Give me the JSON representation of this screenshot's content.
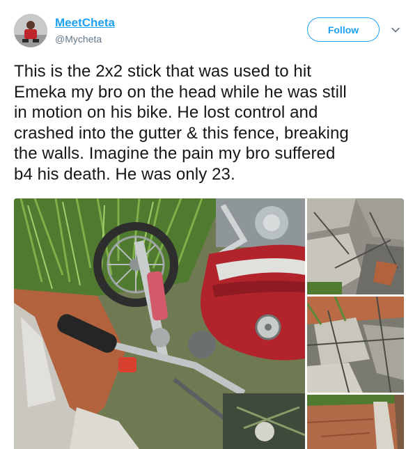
{
  "author": {
    "display_name": "MeetCheta",
    "handle": "@Mycheta",
    "avatar_icon": "profile-avatar"
  },
  "actions": {
    "follow_label": "Follow",
    "more_icon": "chevron-down-icon"
  },
  "tweet": {
    "text_lines": [
      "This is the 2x2 stick that was used to hit",
      "Emeka my bro on the head while he was still",
      "in motion on his bike. He lost control and",
      "crashed into the gutter & this fence, breaking",
      "the walls. Imagine the pain my bro suffered",
      "b4 his death. He was only 23."
    ]
  },
  "media": {
    "photo_count": 4
  },
  "colors": {
    "accent": "#1da1f2",
    "text": "#14171a",
    "secondary_text": "#657786"
  }
}
